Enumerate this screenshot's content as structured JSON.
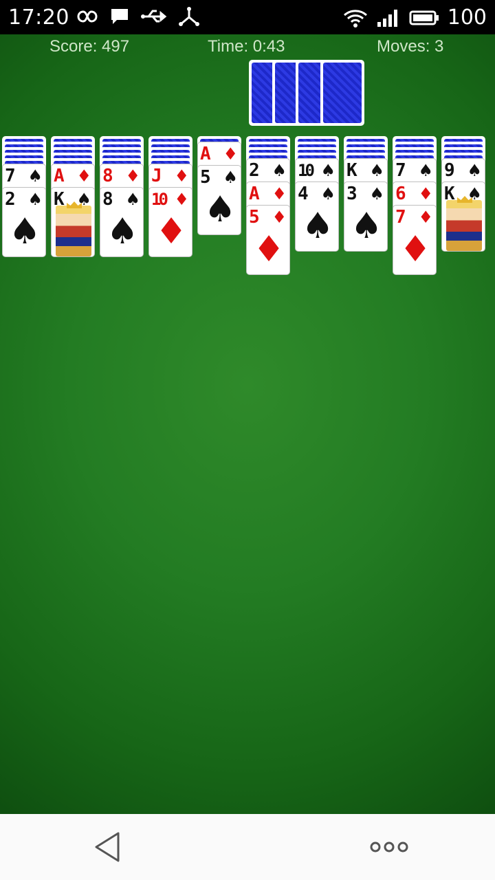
{
  "status_bar": {
    "time": "17:20",
    "battery": "100",
    "icons_left": [
      "infinity-icon",
      "chat-icon",
      "usb-icon",
      "share-icon"
    ],
    "icons_right": [
      "wifi-icon",
      "signal-icon",
      "battery-icon"
    ]
  },
  "hud": {
    "score": "Score: 497",
    "time": "Time: 0:43",
    "moves": "Moves: 3"
  },
  "tableau": [
    {
      "hidden": 5,
      "cards": [
        {
          "rank": "7",
          "suit": "♠",
          "color": "black"
        },
        {
          "rank": "2",
          "suit": "♠",
          "color": "black"
        }
      ]
    },
    {
      "hidden": 5,
      "cards": [
        {
          "rank": "A",
          "suit": "♦",
          "color": "red"
        },
        {
          "rank": "K",
          "suit": "♠",
          "color": "black",
          "face": true
        }
      ]
    },
    {
      "hidden": 5,
      "cards": [
        {
          "rank": "8",
          "suit": "♦",
          "color": "red"
        },
        {
          "rank": "8",
          "suit": "♠",
          "color": "black"
        }
      ]
    },
    {
      "hidden": 5,
      "cards": [
        {
          "rank": "J",
          "suit": "♦",
          "color": "red"
        },
        {
          "rank": "10",
          "suit": "♦",
          "color": "red"
        }
      ]
    },
    {
      "hidden": 1,
      "cards": [
        {
          "rank": "A",
          "suit": "♦",
          "color": "red"
        },
        {
          "rank": "5",
          "suit": "♠",
          "color": "black"
        }
      ]
    },
    {
      "hidden": 4,
      "cards": [
        {
          "rank": "2",
          "suit": "♠",
          "color": "black"
        },
        {
          "rank": "A",
          "suit": "♦",
          "color": "red"
        },
        {
          "rank": "5",
          "suit": "♦",
          "color": "red"
        }
      ]
    },
    {
      "hidden": 4,
      "cards": [
        {
          "rank": "10",
          "suit": "♠",
          "color": "black"
        },
        {
          "rank": "4",
          "suit": "♠",
          "color": "black"
        }
      ]
    },
    {
      "hidden": 4,
      "cards": [
        {
          "rank": "K",
          "suit": "♠",
          "color": "black"
        },
        {
          "rank": "3",
          "suit": "♠",
          "color": "black"
        }
      ]
    },
    {
      "hidden": 4,
      "cards": [
        {
          "rank": "7",
          "suit": "♠",
          "color": "black"
        },
        {
          "rank": "6",
          "suit": "♦",
          "color": "red"
        },
        {
          "rank": "7",
          "suit": "♦",
          "color": "red"
        }
      ]
    },
    {
      "hidden": 4,
      "cards": [
        {
          "rank": "9",
          "suit": "♠",
          "color": "black"
        },
        {
          "rank": "K",
          "suit": "♠",
          "color": "black",
          "face": true
        }
      ]
    }
  ],
  "stock_count": 4,
  "nav": {
    "back_icon": "back-triangle-icon",
    "more_icon": "more-dots-icon"
  }
}
